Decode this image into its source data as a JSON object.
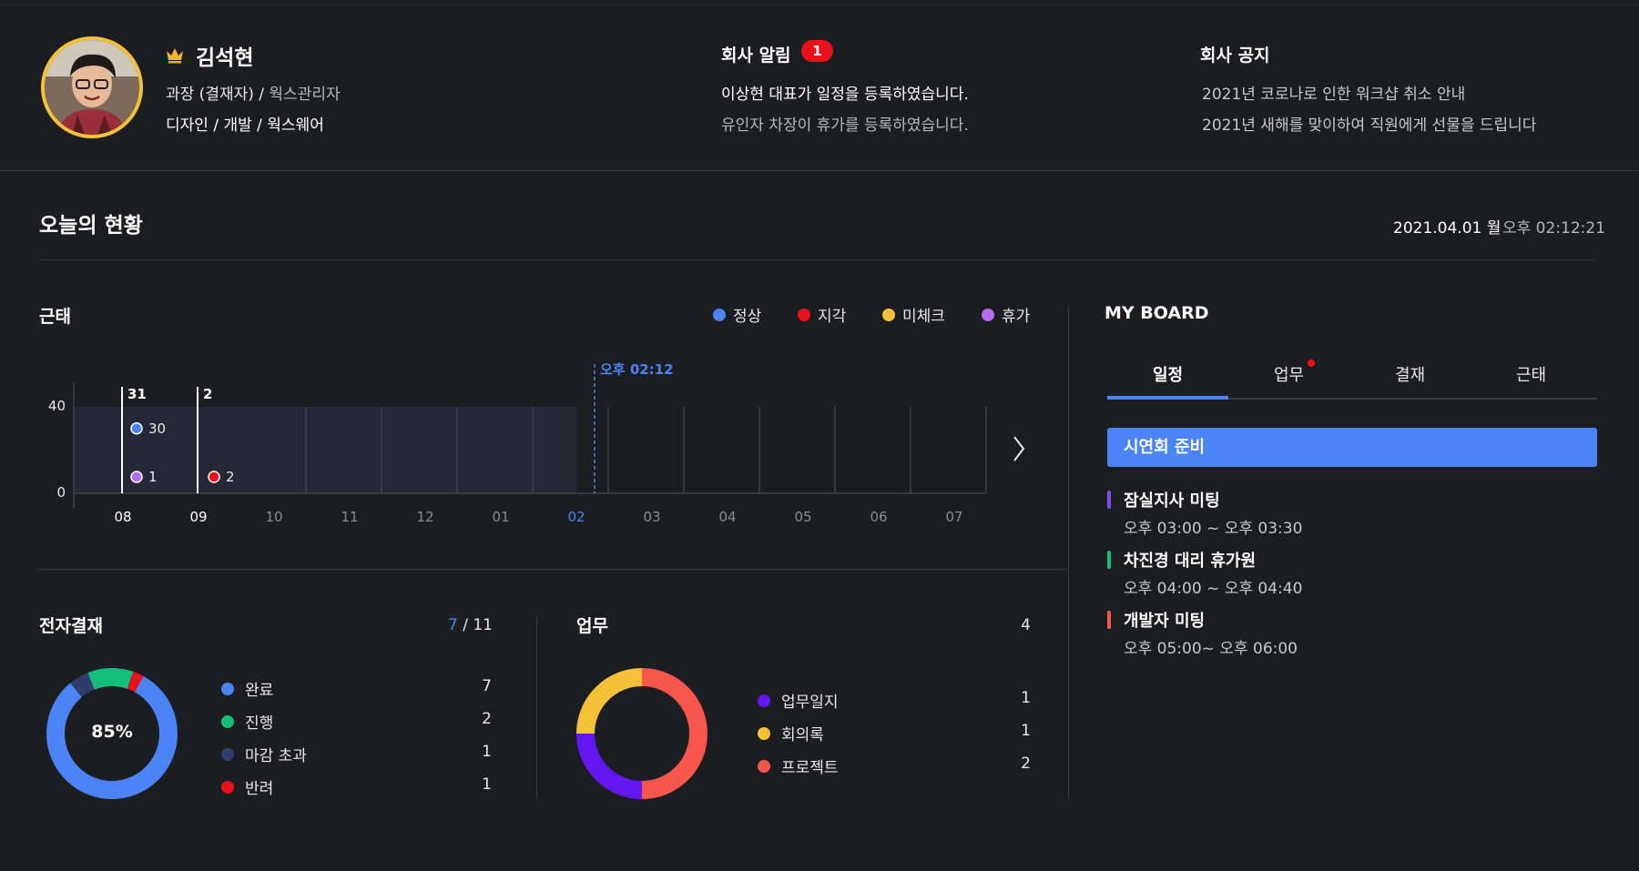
{
  "profile": {
    "name": "김석현",
    "position": "과장 (결재자)",
    "role": "웍스관리자",
    "dept_line": "디자인 / 개발 / 웍스웨어"
  },
  "company_alerts": {
    "title": "회사 알림",
    "badge": "1",
    "items": [
      "이상현 대표가 일정을 등록하였습니다.",
      "유인자 차장이 휴가를 등록하였습니다."
    ]
  },
  "company_notice": {
    "title": "회사 공지",
    "items": [
      "2021년 코로나로 인한 워크샵 취소 안내",
      "2021년 새해를 맞이하여 직원에게 선물을 드립니다"
    ]
  },
  "today": {
    "title": "오늘의 현황",
    "date": "2021.04.01 월",
    "time": "오후 02:12:21"
  },
  "attendance": {
    "title": "근태",
    "legend": [
      {
        "label": "정상",
        "color": "#4a84f5"
      },
      {
        "label": "지각",
        "color": "#e8121a"
      },
      {
        "label": "미체크",
        "color": "#f4c238"
      },
      {
        "label": "휴가",
        "color": "#b36bf0"
      }
    ],
    "now_label": "오후 02:12",
    "next_icon": "chevron-right-icon"
  },
  "chart_data": {
    "type": "scatter",
    "x_categories": [
      "08",
      "09",
      "10",
      "11",
      "12",
      "01",
      "02",
      "03",
      "04",
      "05",
      "06",
      "07"
    ],
    "y_ticks": [
      "40",
      "0"
    ],
    "highlight_x": "02",
    "column_totals": [
      {
        "x": "08",
        "label": "31"
      },
      {
        "x": "09",
        "label": "2"
      }
    ],
    "points": [
      {
        "x": "08",
        "series": "정상",
        "value": 30,
        "color": "#4a84f5"
      },
      {
        "x": "08",
        "series": "휴가",
        "value": 1,
        "color": "#b36bf0"
      },
      {
        "x": "09",
        "series": "지각",
        "value": 2,
        "color": "#e8121a"
      }
    ]
  },
  "approval": {
    "title": "전자결재",
    "done": "7",
    "total": "/ 11",
    "percent": "85%",
    "items": [
      {
        "label": "완료",
        "value": "7",
        "color": "#4a84f5"
      },
      {
        "label": "진행",
        "value": "2",
        "color": "#12c07a"
      },
      {
        "label": "마감 초과",
        "value": "1",
        "color": "#2e3d6b"
      },
      {
        "label": "반려",
        "value": "1",
        "color": "#e8121a"
      }
    ]
  },
  "work": {
    "title": "업무",
    "count": "4",
    "items": [
      {
        "label": "업무일지",
        "value": "1",
        "color": "#6416f0"
      },
      {
        "label": "회의록",
        "value": "1",
        "color": "#f4c238"
      },
      {
        "label": "프로젝트",
        "value": "2",
        "color": "#f5574c"
      }
    ]
  },
  "board": {
    "title": "MY BOARD",
    "tabs": [
      "일정",
      "업무",
      "결재",
      "근태"
    ],
    "highlight_event": "시연회 준비",
    "events": [
      {
        "name": "잠실지사 미팅",
        "time": "오후 03:00 ~ 오후 03:30",
        "color": "#7b4ff0"
      },
      {
        "name": "차진경 대리 휴가원",
        "time": "오후 04:00 ~ 오후 04:40",
        "color": "#12c07a"
      },
      {
        "name": "개발자 미팅",
        "time": "오후 05:00~ 오후 06:00",
        "color": "#f5574c"
      }
    ]
  }
}
